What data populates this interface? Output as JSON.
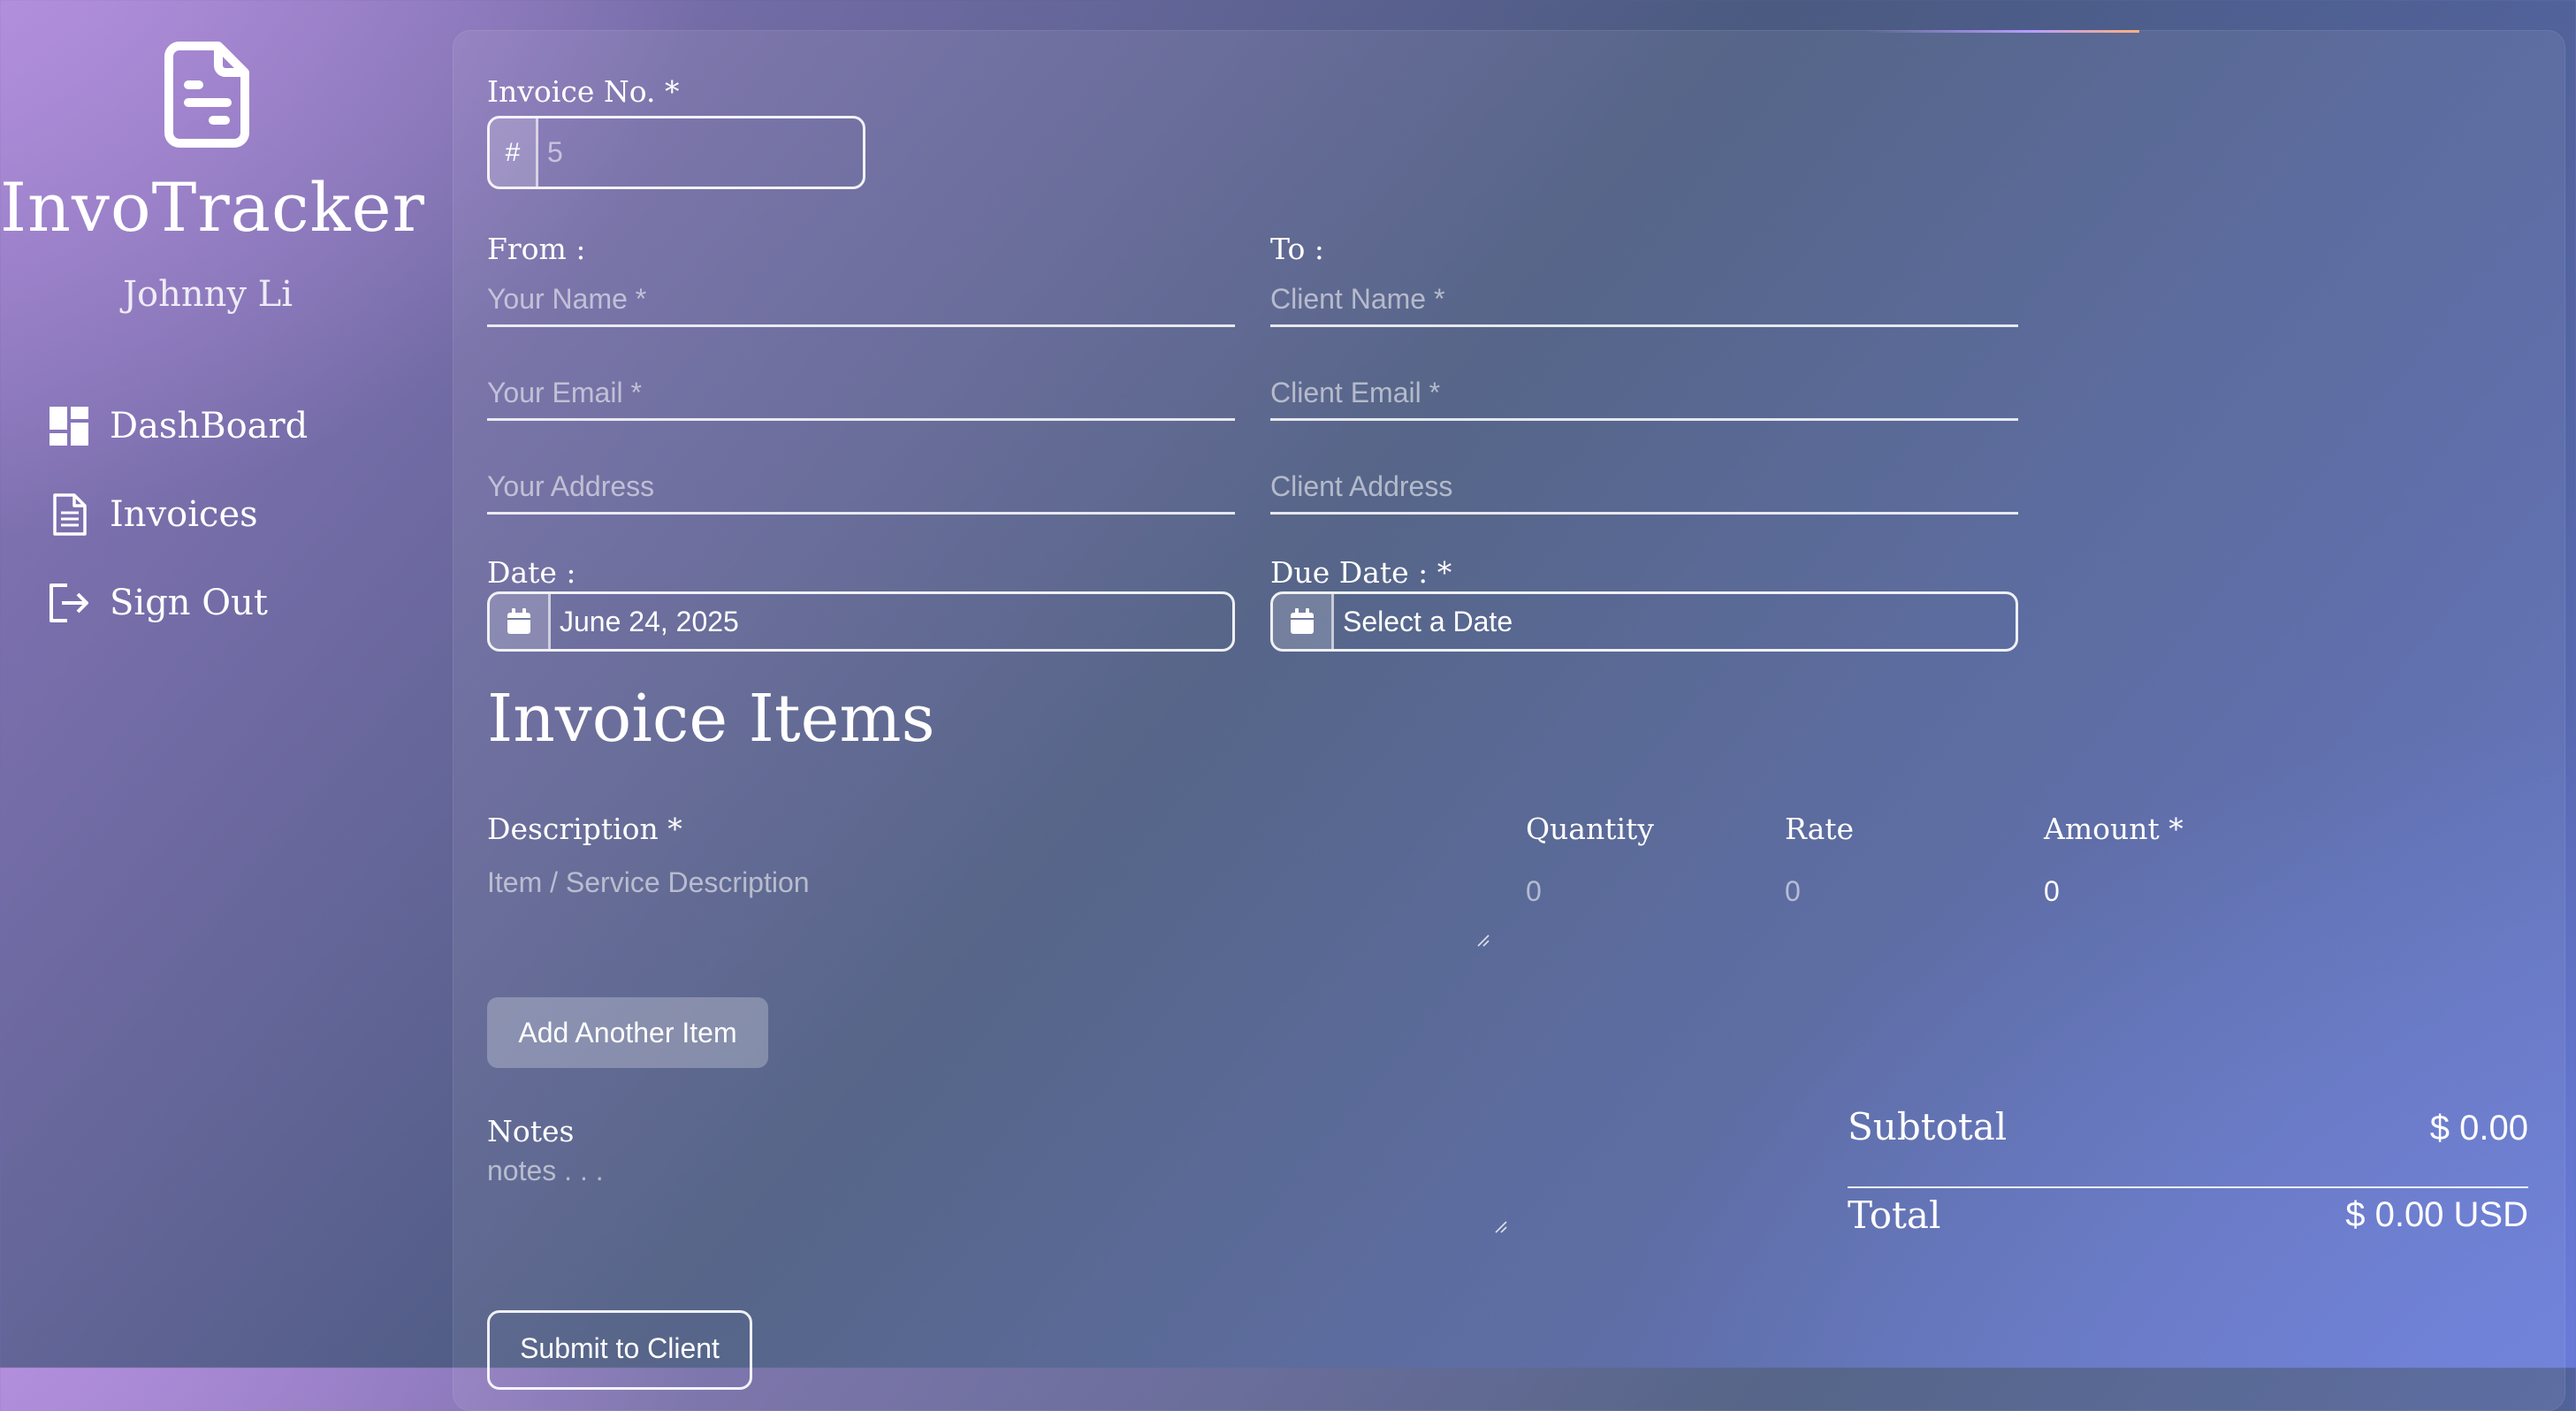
{
  "app": {
    "brand": "InvoTracker",
    "user_name": "Johnny Li",
    "icon": "document-icon"
  },
  "sidebar": {
    "items": [
      {
        "label": "DashBoard",
        "icon": "dashboard-grid-icon"
      },
      {
        "label": "Invoices",
        "icon": "invoice-document-icon"
      },
      {
        "label": "Sign Out",
        "icon": "sign-out-icon"
      }
    ]
  },
  "form": {
    "invoice_no": {
      "label": "Invoice No. *",
      "prefix": "#",
      "placeholder": "5"
    },
    "from": {
      "label": "From :",
      "name_placeholder": "Your Name *",
      "email_placeholder": "Your Email *",
      "address_placeholder": "Your Address"
    },
    "to": {
      "label": "To :",
      "name_placeholder": "Client Name *",
      "email_placeholder": "Client Email *",
      "address_placeholder": "Client Address"
    },
    "date": {
      "label": "Date :",
      "value": "June 24, 2025"
    },
    "due_date": {
      "label": "Due Date : *",
      "value": "Select a Date"
    }
  },
  "items": {
    "heading": "Invoice Items",
    "columns": {
      "description": "Description *",
      "quantity": "Quantity",
      "rate": "Rate",
      "amount": "Amount *"
    },
    "row": {
      "description_placeholder": "Item / Service Description",
      "quantity_placeholder": "0",
      "rate_placeholder": "0",
      "amount": "0"
    },
    "add_button": "Add Another Item"
  },
  "notes": {
    "label": "Notes",
    "placeholder": "notes . . ."
  },
  "totals": {
    "subtotal_label": "Subtotal",
    "subtotal_value": "$ 0.00",
    "total_label": "Total",
    "total_value": "$ 0.00 USD"
  },
  "submit_button": "Submit to Client"
}
